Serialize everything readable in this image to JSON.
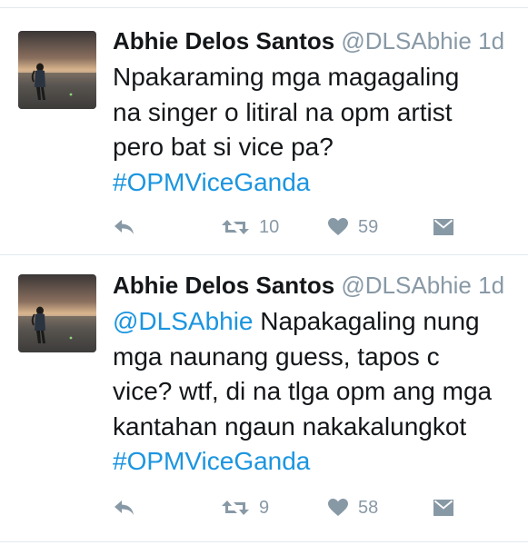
{
  "tweets": [
    {
      "author_name": "Abhie Delos Santos",
      "handle": "@DLSAbhie",
      "time": "1d",
      "text_lines": [
        [
          {
            "t": "Npakaraming mga magagaling",
            "link": false
          }
        ],
        [
          {
            "t": "na singer o litiral na opm artist",
            "link": false
          }
        ],
        [
          {
            "t": "pero bat si vice pa?",
            "link": false
          }
        ],
        [
          {
            "t": "#OPMViceGanda",
            "link": true
          }
        ]
      ],
      "reply_icon": "reply-icon",
      "retweet_icon": "retweet-icon",
      "retweets": "10",
      "like_icon": "heart-icon",
      "likes": "59",
      "dm_icon": "direct-message-icon"
    },
    {
      "author_name": "Abhie Delos Santos",
      "handle": "@DLSAbhie",
      "time": "1d",
      "text_lines": [
        [
          {
            "t": "@DLSAbhie",
            "link": true
          },
          {
            "t": " Napakagaling nung",
            "link": false
          }
        ],
        [
          {
            "t": "mga naunang guess, tapos c",
            "link": false
          }
        ],
        [
          {
            "t": "vice? wtf, di na tlga opm ang mga",
            "link": false
          }
        ],
        [
          {
            "t": "kantahan ngaun nakakalungkot",
            "link": false
          }
        ],
        [
          {
            "t": "#OPMViceGanda",
            "link": true
          }
        ]
      ],
      "reply_icon": "reply-icon",
      "retweet_icon": "retweet-icon",
      "retweets": "9",
      "like_icon": "heart-icon",
      "likes": "58",
      "dm_icon": "direct-message-icon"
    }
  ],
  "colors": {
    "link": "#1b95e0",
    "muted": "#8899a6",
    "text": "#14171a",
    "divider": "#e1e8ed"
  }
}
